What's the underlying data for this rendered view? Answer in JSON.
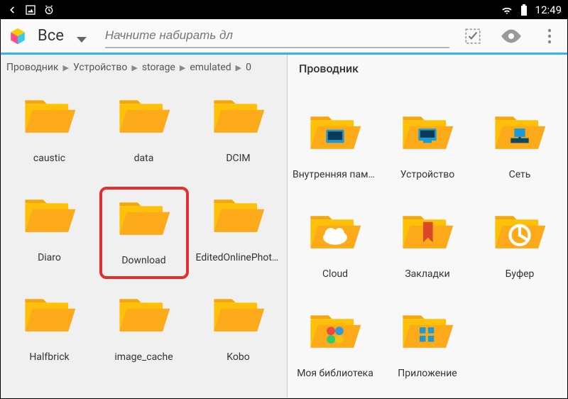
{
  "statusbar": {
    "time": "12:49"
  },
  "header": {
    "dropdown_label": "Все",
    "search_placeholder": "Начните набирать дл"
  },
  "breadcrumb": {
    "items": [
      "Проводник",
      "Устройство",
      "storage",
      "emulated",
      "0"
    ]
  },
  "left_grid": {
    "items": [
      {
        "label": "caustic",
        "type": "folder",
        "highlighted": false
      },
      {
        "label": "data",
        "type": "folder",
        "highlighted": false
      },
      {
        "label": "DCIM",
        "type": "folder",
        "highlighted": false
      },
      {
        "label": "Diaro",
        "type": "folder",
        "highlighted": false
      },
      {
        "label": "Download",
        "type": "folder",
        "highlighted": true
      },
      {
        "label": "EditedOnlinePhotos",
        "type": "folder",
        "highlighted": false
      },
      {
        "label": "Halfbrick",
        "type": "folder",
        "highlighted": false
      },
      {
        "label": "image_cache",
        "type": "folder",
        "highlighted": false
      },
      {
        "label": "Kobo",
        "type": "folder",
        "highlighted": false
      }
    ]
  },
  "right_pane": {
    "title": "Проводник",
    "items": [
      {
        "label": "Внутренняя память",
        "icon": "internal"
      },
      {
        "label": "Устройство",
        "icon": "device"
      },
      {
        "label": "Сеть",
        "icon": "network"
      },
      {
        "label": "Cloud",
        "icon": "cloud"
      },
      {
        "label": "Закладки",
        "icon": "bookmarks"
      },
      {
        "label": "Буфер",
        "icon": "buffer"
      },
      {
        "label": "Моя библиотека",
        "icon": "library"
      },
      {
        "label": "Приложение",
        "icon": "apps"
      }
    ]
  }
}
